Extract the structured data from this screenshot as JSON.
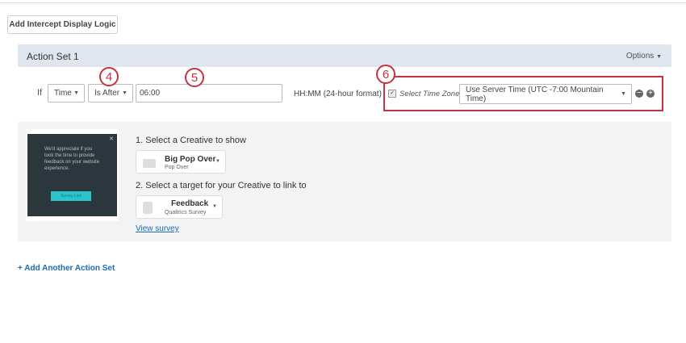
{
  "toolbar": {
    "add_logic": "Add Intercept Display Logic"
  },
  "action_set": {
    "title": "Action Set 1",
    "options": "Options",
    "condition": {
      "if": "If",
      "field": "Time",
      "operator": "Is After",
      "value": "06:00",
      "format_hint": "HH:MM (24-hour format)",
      "tz_label": "Select Time Zone",
      "tz_value": "Use Server Time (UTC -7:00 Mountain Time)",
      "tz_checked": true
    },
    "preview": {
      "text": "We'd appreciate if you took the time to provide feedback on your website experience.",
      "button": "Survey Link"
    },
    "step1": "1. Select a Creative to show",
    "creative": {
      "name": "Big Pop Over",
      "type": "Pop Over"
    },
    "step2": "2. Select a target for your Creative to link to",
    "target": {
      "name": "Feedback",
      "type": "Qualtrics Survey"
    },
    "view_survey": "View survey"
  },
  "callouts": [
    "4",
    "5",
    "6"
  ],
  "add_action_set": "+ Add Another Action Set",
  "colors": {
    "callout": "#c9313e",
    "link": "#1a6bb3",
    "header": "#dfe6ed"
  }
}
